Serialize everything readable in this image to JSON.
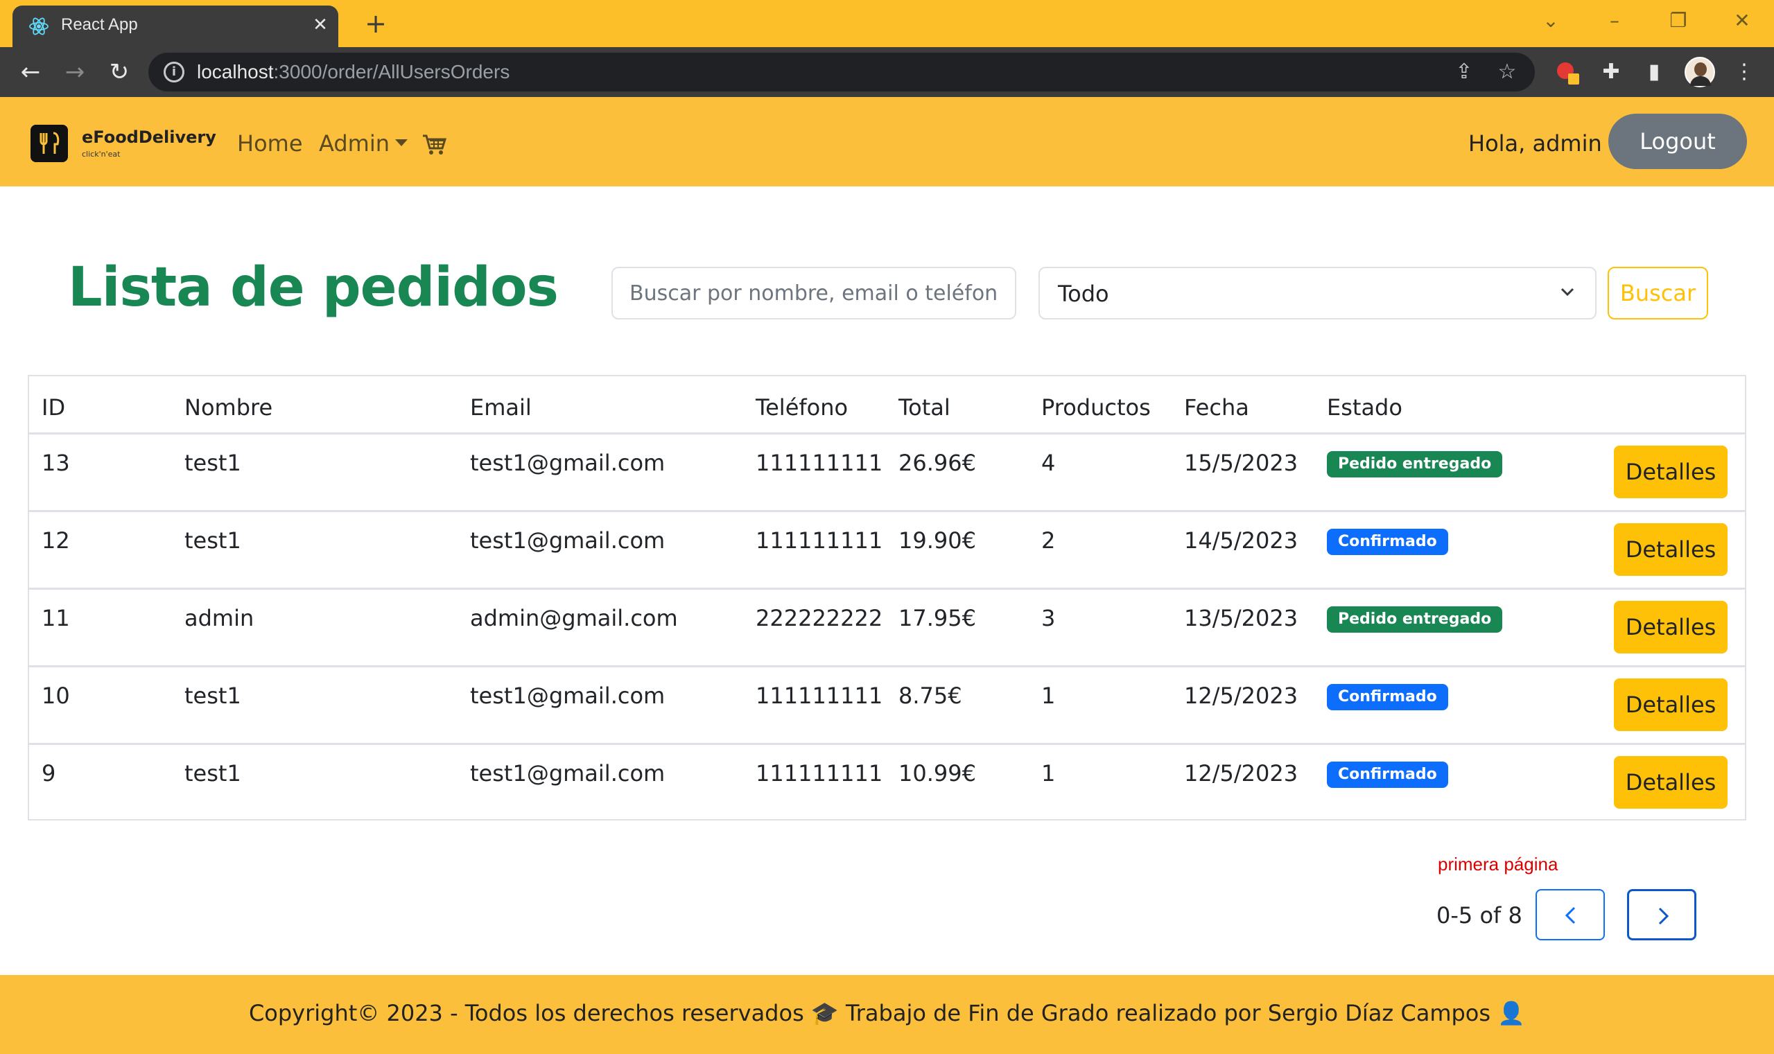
{
  "browser": {
    "tab_title": "React App",
    "tab_close": "✕",
    "new_tab": "+",
    "url_host": "localhost",
    "url_path": ":3000/order/AllUsersOrders"
  },
  "navbar": {
    "brand_name": "eFoodDelivery",
    "brand_tagline": "click'n'eat",
    "home_label": "Home",
    "admin_label": "Admin",
    "greeting": "Hola, admin",
    "logout_label": "Logout",
    "cart_icon": "cart-icon"
  },
  "main": {
    "title": "Lista de pedidos",
    "search_placeholder": "Buscar por nombre, email o teléfono",
    "status_filter_value": "Todo",
    "search_button": "Buscar"
  },
  "table": {
    "headers": [
      "ID",
      "Nombre",
      "Email",
      "Teléfono",
      "Total",
      "Productos",
      "Fecha",
      "Estado"
    ],
    "details_label": "Detalles",
    "rows": [
      {
        "id": "13",
        "name": "test1",
        "email": "test1@gmail.com",
        "phone": "111111111",
        "total": "26.96€",
        "products": "4",
        "date": "15/5/2023",
        "status": "Pedido entregado",
        "status_color": "#198754"
      },
      {
        "id": "12",
        "name": "test1",
        "email": "test1@gmail.com",
        "phone": "111111111",
        "total": "19.90€",
        "products": "2",
        "date": "14/5/2023",
        "status": "Confirmado",
        "status_color": "#0d6efd"
      },
      {
        "id": "11",
        "name": "admin",
        "email": "admin@gmail.com",
        "phone": "222222222",
        "total": "17.95€",
        "products": "3",
        "date": "13/5/2023",
        "status": "Pedido entregado",
        "status_color": "#198754"
      },
      {
        "id": "10",
        "name": "test1",
        "email": "test1@gmail.com",
        "phone": "111111111",
        "total": "8.75€",
        "products": "1",
        "date": "12/5/2023",
        "status": "Confirmado",
        "status_color": "#0d6efd"
      },
      {
        "id": "9",
        "name": "test1",
        "email": "test1@gmail.com",
        "phone": "111111111",
        "total": "10.99€",
        "products": "1",
        "date": "12/5/2023",
        "status": "Confirmado",
        "status_color": "#0d6efd"
      }
    ]
  },
  "pagination": {
    "first_page_msg": "primera página",
    "range": "0-5 of 8"
  },
  "footer": {
    "text": "Copyright© 2023 - Todos los derechos reservados 🎓 Trabajo de Fin de Grado realizado por Sergio Díaz Campos 👤"
  },
  "colors": {
    "brand_yellow": "#fcbf3c",
    "title_green": "#198754",
    "badge_green": "#198754",
    "badge_blue": "#0d6efd",
    "button_yellow": "#ffc107",
    "logout_gray": "#6c757d",
    "error_red": "#dc0000"
  }
}
